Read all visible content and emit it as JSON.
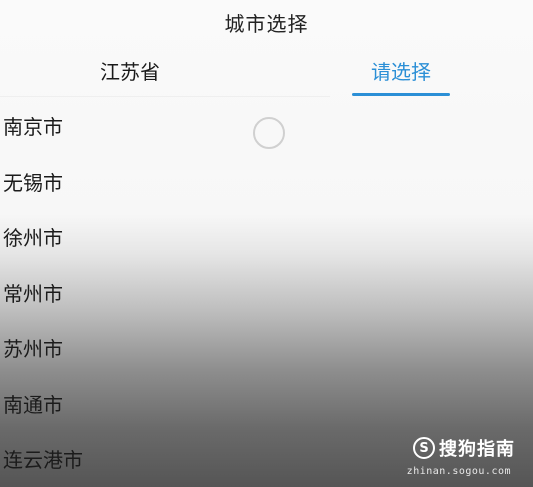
{
  "header": {
    "title": "城市选择"
  },
  "tabs": [
    {
      "label": "江苏省"
    },
    {
      "label": "请选择"
    }
  ],
  "accent_color": "#2b8fd6",
  "cities": [
    {
      "label": "南京市"
    },
    {
      "label": "无锡市"
    },
    {
      "label": "徐州市"
    },
    {
      "label": "常州市"
    },
    {
      "label": "苏州市"
    },
    {
      "label": "南通市"
    },
    {
      "label": "连云港市"
    }
  ],
  "watermark": {
    "logo_letter": "S",
    "name": "搜狗指南",
    "url": "zhinan.sogou.com"
  }
}
